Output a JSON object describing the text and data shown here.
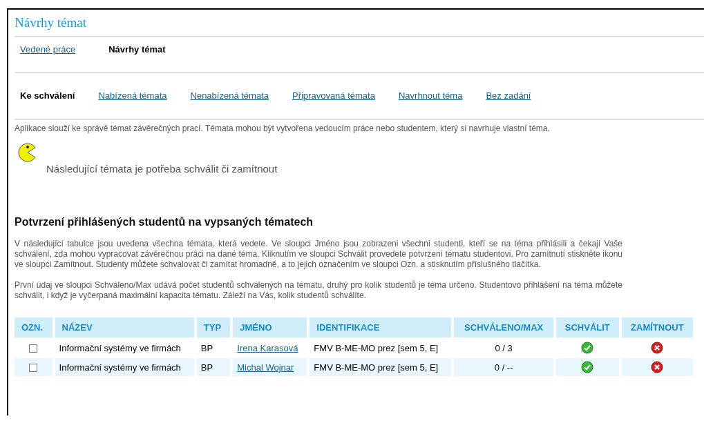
{
  "title": "Návrhy témat",
  "subnav": [
    {
      "label": "Vedené práce",
      "selected": false
    },
    {
      "label": "Návrhy témat",
      "selected": true
    }
  ],
  "tabs": [
    {
      "label": "Ke schválení",
      "selected": true
    },
    {
      "label": "Nabízená témata",
      "selected": false
    },
    {
      "label": "Nenabízená témata",
      "selected": false
    },
    {
      "label": "Připravovaná témata",
      "selected": false
    },
    {
      "label": "Navrhnout téma",
      "selected": false
    },
    {
      "label": "Bez zadání",
      "selected": false
    }
  ],
  "intro": "Aplikace slouží ke správě témat závěrečných prací. Témata mohou být vytvořena vedoucím práce nebo studentem, který si navrhuje vlastní téma.",
  "notice": "Následující témata je potřeba schválit či zamítnout",
  "section_heading": "Potvrzení přihlášených studentů na vypsaných tématech",
  "paragraphs": [
    "V následující tabulce jsou uvedena všechna témata, která vedete. Ve sloupci Jméno jsou zobrazeni všechni studenti, kteří se na téma přihlásili a čekají Vaše schválení, zda mohou vypracovat závěrečnou práci na dané téma. Kliknutím ve sloupci Schválit provedete potvrzení tématu studentovi. Pro zamítnutí stiskněte ikonu ve sloupci Zamítnout. Studenty můžete schvalovat či zamítat hromadně, a to jejich označením ve sloupci Ozn. a stisknutím příslušného tlačítka.",
    "První údaj ve sloupci Schváleno/Max udává počet studentů schválených na tématu, druhý pro kolik studentů je téma určeno. Studentovo přihlášení na téma můžete schválit, i když je vyčerpaná maximální kapacita tématu. Záleží na Vás, kolik studentů schválíte."
  ],
  "table": {
    "columns": [
      "OZN.",
      "NÁZEV",
      "TYP",
      "JMÉNO",
      "IDENTIFIKACE",
      "SCHVÁLENO/MAX",
      "SCHVÁLIT",
      "ZAMÍTNOUT"
    ],
    "rows": [
      {
        "checked": false,
        "name": "Informační systémy ve firmách",
        "type": "BP",
        "student": "Irena Karasová",
        "identification": "FMV B-ME-MO prez [sem 5, E]",
        "approved_max": "0 / 3"
      },
      {
        "checked": false,
        "name": "Informační systémy ve firmách",
        "type": "BP",
        "student": "Michal Wojnar",
        "identification": "FMV B-ME-MO prez [sem 5, E]",
        "approved_max": "0 / --"
      }
    ]
  }
}
